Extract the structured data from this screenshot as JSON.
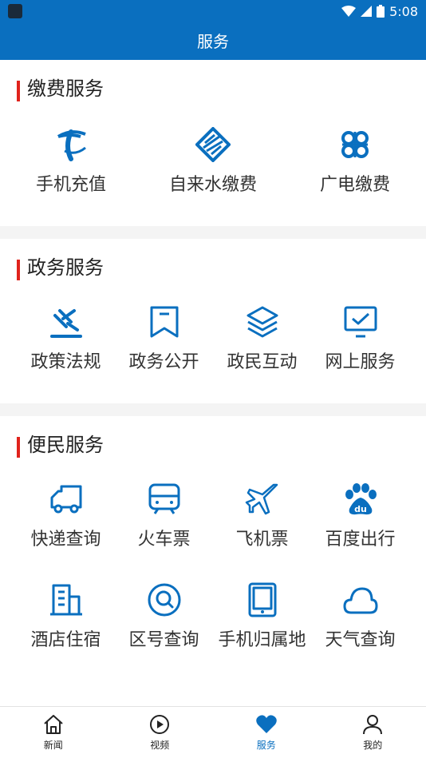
{
  "status": {
    "time": "5:08"
  },
  "header": {
    "title": "服务"
  },
  "sections": [
    {
      "title": "缴费服务",
      "items": [
        {
          "label": "手机充值",
          "icon": "china-telecom-icon"
        },
        {
          "label": "自来水缴费",
          "icon": "water-bill-icon"
        },
        {
          "label": "广电缴费",
          "icon": "broadcast-tv-icon"
        }
      ]
    },
    {
      "title": "政务服务",
      "items": [
        {
          "label": "政策法规",
          "icon": "gavel-icon"
        },
        {
          "label": "政务公开",
          "icon": "bookmark-icon"
        },
        {
          "label": "政民互动",
          "icon": "layers-icon"
        },
        {
          "label": "网上服务",
          "icon": "monitor-check-icon"
        }
      ]
    },
    {
      "title": "便民服务",
      "items": [
        {
          "label": "快递查询",
          "icon": "delivery-truck-icon"
        },
        {
          "label": "火车票",
          "icon": "train-icon"
        },
        {
          "label": "飞机票",
          "icon": "airplane-icon"
        },
        {
          "label": "百度出行",
          "icon": "baidu-paw-icon"
        },
        {
          "label": "酒店住宿",
          "icon": "hotel-building-icon"
        },
        {
          "label": "区号查询",
          "icon": "search-circle-icon"
        },
        {
          "label": "手机归属地",
          "icon": "tablet-icon"
        },
        {
          "label": "天气查询",
          "icon": "cloud-icon"
        }
      ]
    }
  ],
  "nav": [
    {
      "label": "新闻",
      "icon": "home-icon"
    },
    {
      "label": "视频",
      "icon": "play-icon"
    },
    {
      "label": "服务",
      "icon": "heart-icon",
      "active": true
    },
    {
      "label": "我的",
      "icon": "user-icon"
    }
  ],
  "colors": {
    "primary": "#0a6fbf",
    "accent_bar": "#e0231c"
  }
}
